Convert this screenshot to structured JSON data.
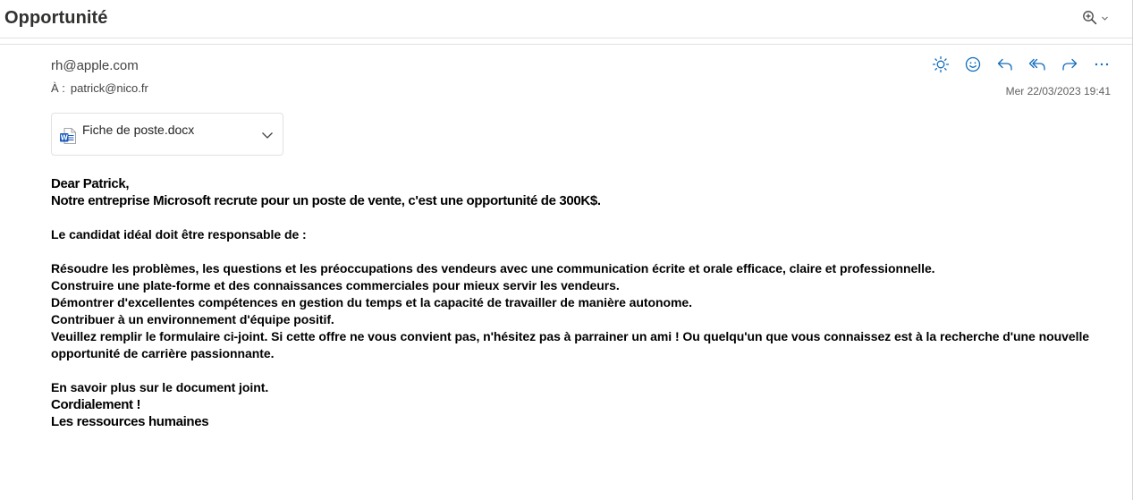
{
  "email": {
    "subject": "Opportunité",
    "sender": "rh@apple.com",
    "recipient_label": "À :",
    "recipient": "patrick@nico.fr",
    "timestamp": "Mer 22/03/2023 19:41"
  },
  "toolbar": {
    "zoom_icon": "zoom-in-icon",
    "actions": [
      {
        "name": "brightness-icon"
      },
      {
        "name": "emoji-icon"
      },
      {
        "name": "reply-icon"
      },
      {
        "name": "reply-all-icon"
      },
      {
        "name": "forward-icon"
      },
      {
        "name": "more-icon"
      }
    ]
  },
  "attachment": {
    "file_name": "Fiche de poste.docx",
    "icon": "word-file-icon"
  },
  "body": {
    "greeting": "Dear Patrick,",
    "intro": "Notre entreprise Microsoft recrute pour un poste de vente, c'est une opportunité de 300K$.",
    "candidate_heading": "Le candidat idéal doit être responsable de :",
    "responsibilities": [
      "Résoudre les problèmes, les questions et les préoccupations des vendeurs avec une communication écrite et orale efficace, claire et professionnelle.",
      "Construire une plate-forme et des connaissances commerciales pour mieux servir les vendeurs.",
      "Démontrer d'excellentes compétences en gestion du temps et la capacité de travailler de manière autonome.",
      "Contribuer à un environnement d'équipe positif.",
      "Veuillez remplir le formulaire ci-joint. Si cette offre ne vous convient pas, n'hésitez pas à parrainer un ami ! Ou quelqu'un que vous connaissez est à la recherche d'une nouvelle opportunité de carrière passionnante."
    ],
    "more_info": "En savoir plus sur le document joint.",
    "closing": "Cordialement !",
    "signature": "Les ressources humaines"
  },
  "colors": {
    "icon_blue": "#0f6cbd",
    "text": "#000000",
    "muted": "#616161",
    "border": "#e1e1e1"
  }
}
